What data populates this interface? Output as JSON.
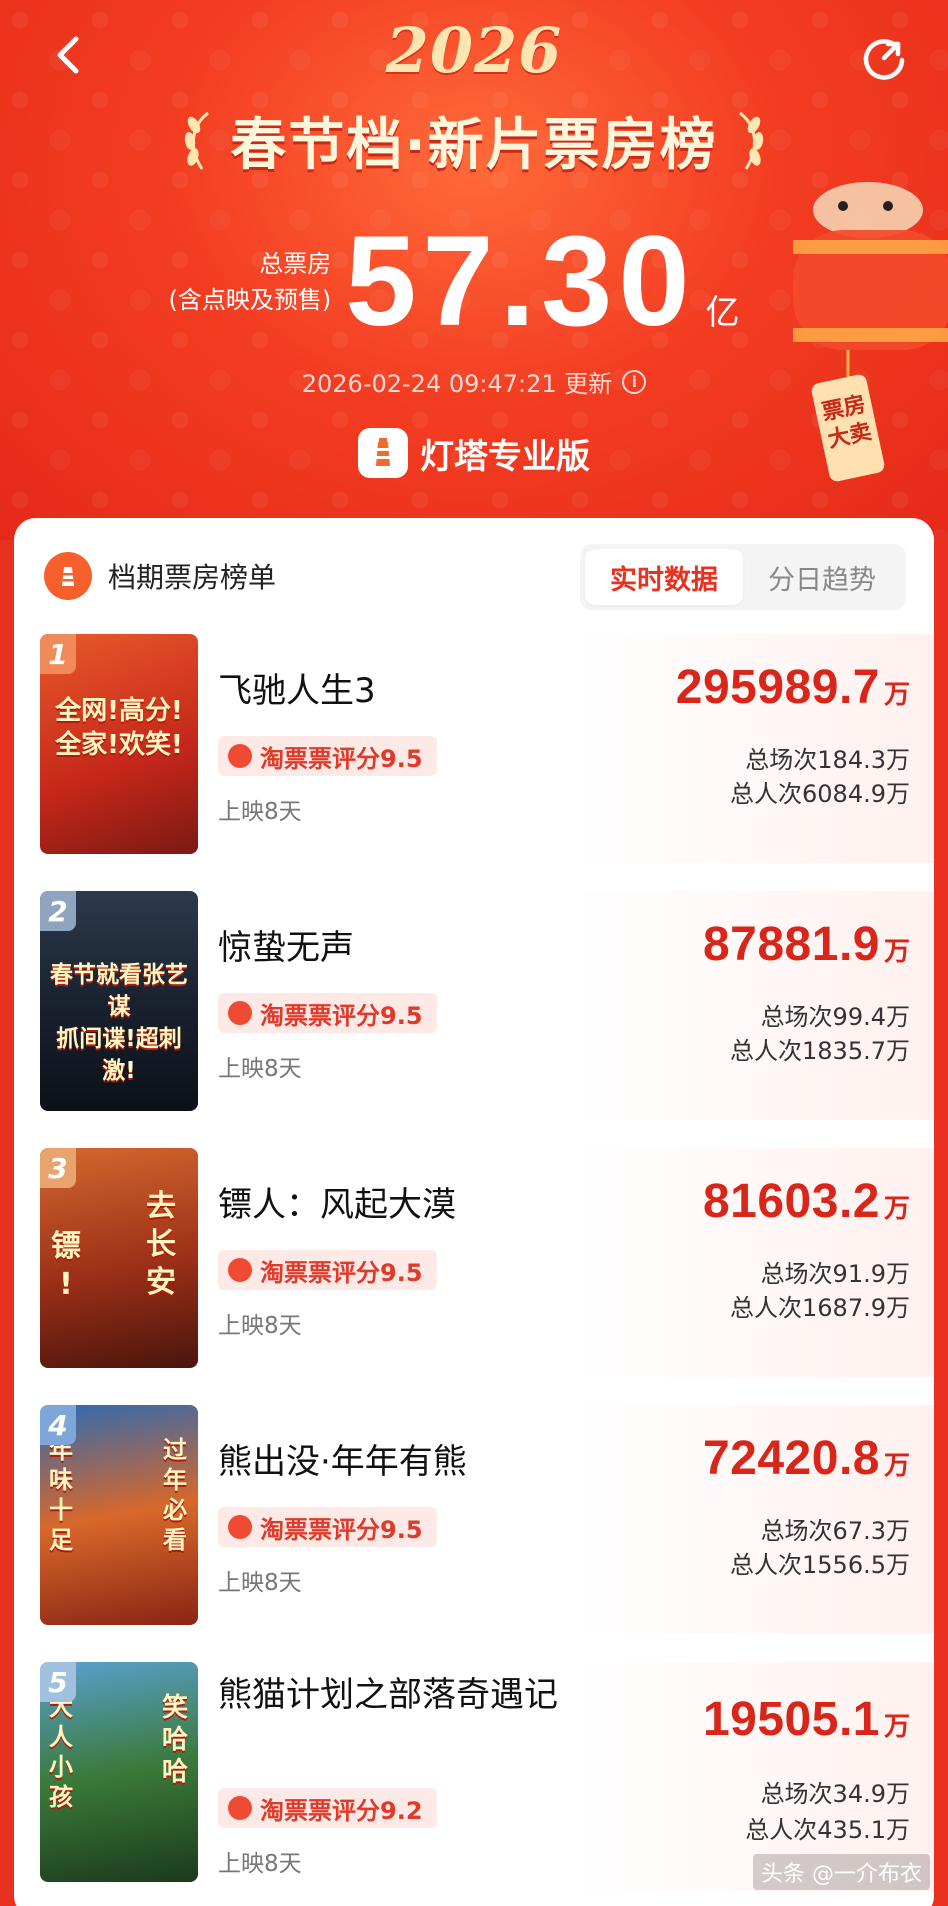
{
  "header": {
    "year": "2026",
    "title": "春节档·新片票房榜",
    "total_label_line1": "总票房",
    "total_label_line2": "(含点映及预售)",
    "total_value": "57.30",
    "total_unit": "亿",
    "update_time": "2026-02-24 09:47:21 更新",
    "brand": "灯塔专业版",
    "lantern_text": "票房大卖"
  },
  "card": {
    "title": "档期票房榜单",
    "tabs": [
      {
        "label": "实时数据",
        "active": true
      },
      {
        "label": "分日趋势",
        "active": false
      }
    ]
  },
  "movies": [
    {
      "rank": "1",
      "title": "飞驰人生3",
      "rating": "淘票票评分9.5",
      "days": "上映8天",
      "box": "295989.7",
      "unit": "万",
      "screenings": "总场次184.3万",
      "admissions": "总人次6084.9万",
      "poster_text": "全网!高分!全家!欢笑!",
      "poster_color": "#d4301c"
    },
    {
      "rank": "2",
      "title": "惊蛰无声",
      "rating": "淘票票评分9.5",
      "days": "上映8天",
      "box": "87881.9",
      "unit": "万",
      "screenings": "总场次99.4万",
      "admissions": "总人次1835.7万",
      "poster_text": "春节就看张艺谋 抓间谍!超刺激!",
      "poster_color": "#1c2a3a"
    },
    {
      "rank": "3",
      "title": "镖人：风起大漠",
      "rating": "淘票票评分9.5",
      "days": "上映8天",
      "box": "81603.2",
      "unit": "万",
      "screenings": "总场次91.9万",
      "admissions": "总人次1687.9万",
      "poster_text": "去长安 镖!",
      "poster_color": "#a8341b"
    },
    {
      "rank": "4",
      "title": "熊出没·年年有熊",
      "rating": "淘票票评分9.5",
      "days": "上映8天",
      "box": "72420.8",
      "unit": "万",
      "screenings": "总场次67.3万",
      "admissions": "总人次1556.5万",
      "poster_text": "年味十足 过年必看",
      "poster_color": "#c8431f"
    },
    {
      "rank": "5",
      "title": "熊猫计划之部落奇遇记",
      "rating": "淘票票评分9.2",
      "days": "上映8天",
      "box": "19505.1",
      "unit": "万",
      "screenings": "总场次34.9万",
      "admissions": "总人次435.1万",
      "poster_text": "大人小孩 笑哈哈",
      "poster_color": "#3a7a3a"
    }
  ],
  "watermark": "头条 @一介布衣",
  "colors": {
    "accent": "#e8321f",
    "box_red": "#d8261a",
    "rating_bg": "#fde9e6"
  }
}
